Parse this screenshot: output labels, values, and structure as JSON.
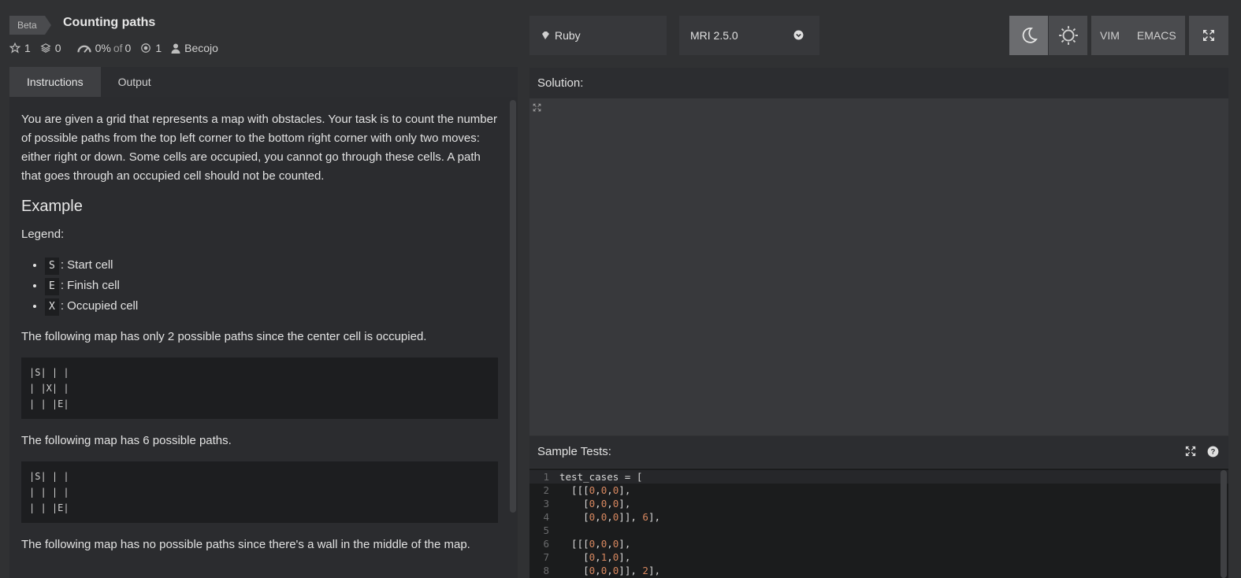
{
  "header": {
    "beta": "Beta",
    "title": "Counting paths",
    "stars": "1",
    "collections": "0",
    "satisfaction": "0%",
    "of_label": "of",
    "votes": "0",
    "completed": "1",
    "author": "Becojo"
  },
  "toolbar": {
    "language": "Ruby",
    "version": "MRI 2.5.0",
    "vim": "VIM",
    "emacs": "EMACS"
  },
  "tabs": {
    "instructions": "Instructions",
    "output": "Output"
  },
  "instructions": {
    "intro": "You are given a grid that represents a map with obstacles. Your task is to count the number of possible paths from the top left corner to the bottom right corner with only two moves: either right or down. Some cells are occupied, you cannot go through these cells. A path that goes through an occupied cell should not be counted.",
    "example_heading": "Example",
    "legend_label": "Legend:",
    "legend": [
      {
        "code": "S",
        "text": ": Start cell"
      },
      {
        "code": "E",
        "text": ": Finish cell"
      },
      {
        "code": "X",
        "text": ": Occupied cell"
      }
    ],
    "map1_text": "The following map has only 2 possible paths since the center cell is occupied.",
    "map1": "|S| | |\n| |X| |\n| | |E|",
    "map2_text": "The following map has 6 possible paths.",
    "map2": "|S| | |\n| | | |\n| | |E|",
    "map3_text": "The following map has no possible paths since there's a wall in the middle of the map."
  },
  "solution": {
    "label": "Solution:"
  },
  "sample_tests": {
    "label": "Sample Tests:",
    "lines": [
      {
        "n": "1",
        "code": "test_cases = ["
      },
      {
        "n": "2",
        "code": "  [[[0,0,0],"
      },
      {
        "n": "3",
        "code": "    [0,0,0],"
      },
      {
        "n": "4",
        "code": "    [0,0,0]], 6],"
      },
      {
        "n": "5",
        "code": ""
      },
      {
        "n": "6",
        "code": "  [[[0,0,0],"
      },
      {
        "n": "7",
        "code": "    [0,1,0],"
      },
      {
        "n": "8",
        "code": "    [0,0,0]], 2],"
      }
    ]
  },
  "colors": {
    "background": "#303133",
    "panel": "#2b2c2f",
    "code_bg": "#1d1e20",
    "number": "#d7875f"
  }
}
